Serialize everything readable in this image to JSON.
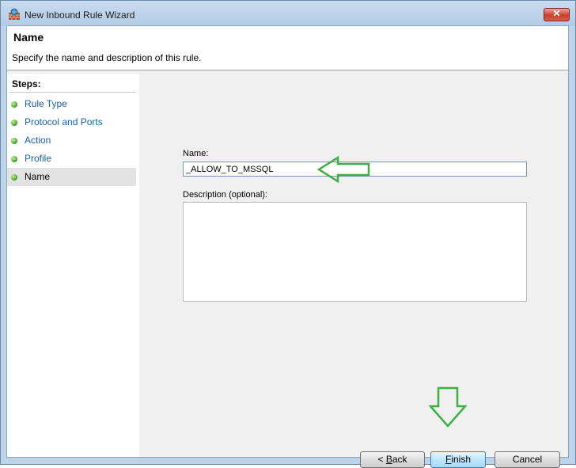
{
  "window": {
    "title": "New Inbound Rule Wizard",
    "close_glyph": "✕"
  },
  "header": {
    "title": "Name",
    "description": "Specify the name and description of this rule."
  },
  "steps": {
    "label": "Steps:",
    "items": [
      {
        "label": "Rule Type"
      },
      {
        "label": "Protocol and Ports"
      },
      {
        "label": "Action"
      },
      {
        "label": "Profile"
      },
      {
        "label": "Name"
      }
    ],
    "current_index": 4
  },
  "form": {
    "name_label": "Name:",
    "name_value": "_ALLOW_TO_MSSQL",
    "description_label": "Description (optional):",
    "description_value": ""
  },
  "buttons": {
    "back_prefix": "< ",
    "back_mnemonic": "B",
    "back_rest": "ack",
    "finish_mnemonic": "F",
    "finish_rest": "inish",
    "cancel": "Cancel"
  },
  "colors": {
    "step_link": "#1b5fa8",
    "annotation_arrow": "#3cb043"
  },
  "icons": {
    "app": "firewall-icon",
    "step_bullet": "green-dot-icon"
  }
}
